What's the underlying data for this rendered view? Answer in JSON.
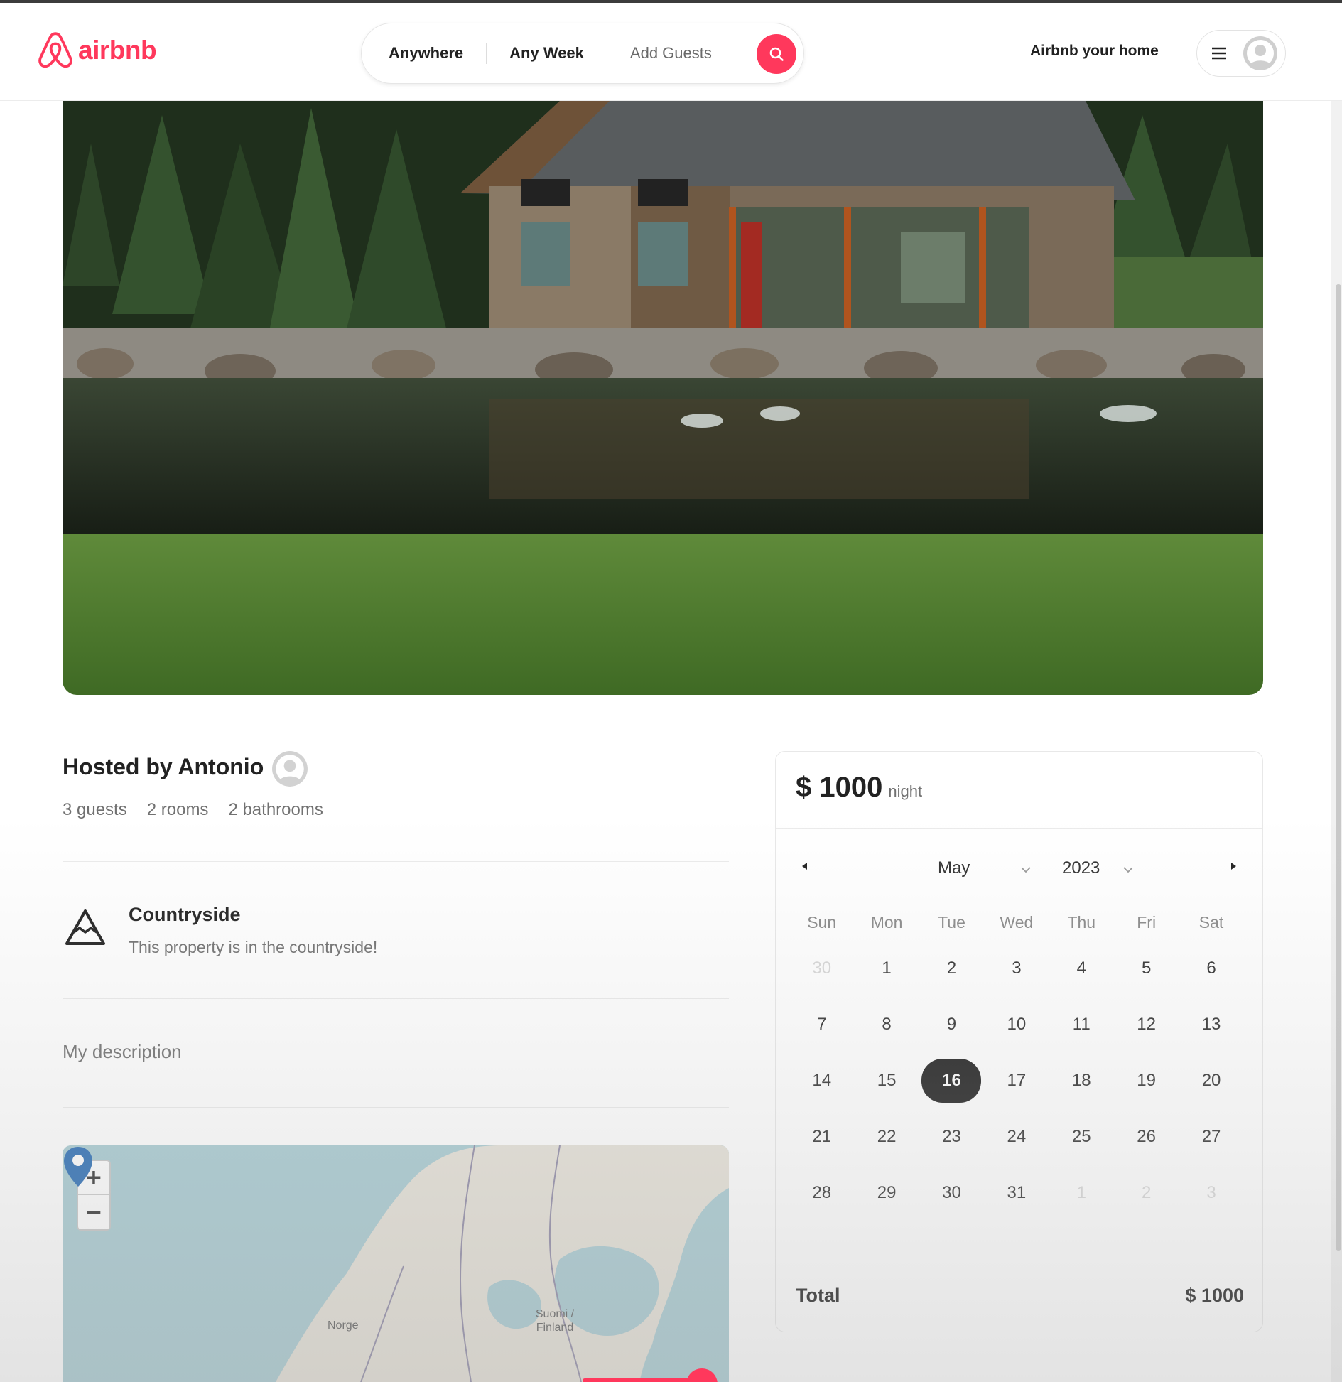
{
  "header": {
    "brand": "airbnb",
    "search": {
      "where": "Anywhere",
      "when": "Any Week",
      "who": "Add Guests"
    },
    "host_link": "Airbnb your home"
  },
  "listing": {
    "hosted_by": "Hosted by Antonio",
    "stats": [
      "3 guests",
      "2 rooms",
      "2 bathrooms"
    ],
    "category": {
      "title": "Countryside",
      "description": "This property is in the countryside!",
      "icon": "mountain-icon"
    },
    "description": "My description"
  },
  "map": {
    "labels": [
      "Norge",
      "Suomi / Finland"
    ],
    "zoom_in": "+",
    "zoom_out": "−"
  },
  "booking": {
    "price": "$ 1000",
    "per": "night",
    "calendar": {
      "month": "May",
      "year": "2023",
      "weekdays": [
        "Sun",
        "Mon",
        "Tue",
        "Wed",
        "Thu",
        "Fri",
        "Sat"
      ],
      "weeks": [
        [
          {
            "d": "30",
            "m": true
          },
          {
            "d": "1"
          },
          {
            "d": "2"
          },
          {
            "d": "3"
          },
          {
            "d": "4"
          },
          {
            "d": "5"
          },
          {
            "d": "6"
          }
        ],
        [
          {
            "d": "7"
          },
          {
            "d": "8"
          },
          {
            "d": "9"
          },
          {
            "d": "10"
          },
          {
            "d": "11"
          },
          {
            "d": "12"
          },
          {
            "d": "13"
          }
        ],
        [
          {
            "d": "14"
          },
          {
            "d": "15"
          },
          {
            "d": "16",
            "s": true
          },
          {
            "d": "17"
          },
          {
            "d": "18"
          },
          {
            "d": "19"
          },
          {
            "d": "20"
          }
        ],
        [
          {
            "d": "21"
          },
          {
            "d": "22"
          },
          {
            "d": "23"
          },
          {
            "d": "24"
          },
          {
            "d": "25"
          },
          {
            "d": "26"
          },
          {
            "d": "27"
          }
        ],
        [
          {
            "d": "28"
          },
          {
            "d": "29"
          },
          {
            "d": "30"
          },
          {
            "d": "31"
          },
          {
            "d": "1",
            "m": true
          },
          {
            "d": "2",
            "m": true
          },
          {
            "d": "3",
            "m": true
          }
        ]
      ]
    },
    "total_label": "Total",
    "total_value": "$ 1000"
  },
  "colors": {
    "brand": "#ff385c",
    "selected_day": "#222222"
  }
}
